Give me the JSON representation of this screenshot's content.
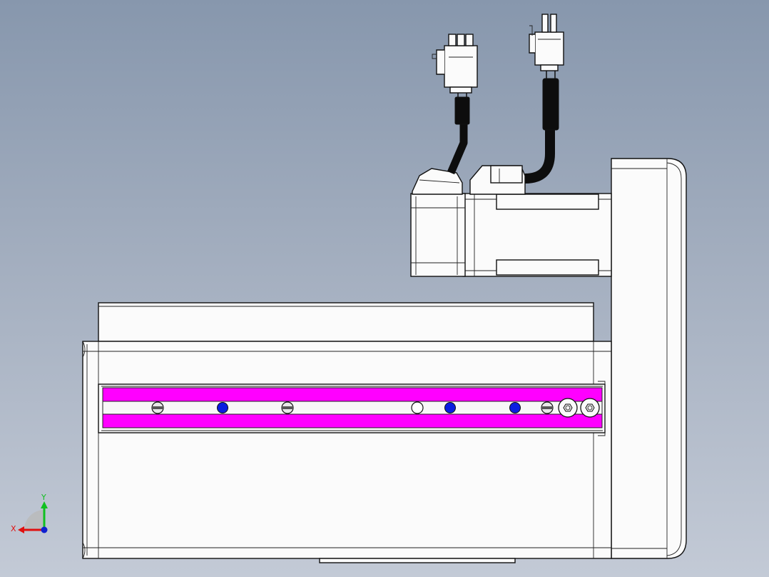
{
  "view": {
    "background_top": "#8797ad",
    "background_bottom": "#c3cad6"
  },
  "colors": {
    "highlight_strip": "#ff00ff",
    "marker_blue": "#0a1ee0",
    "cable": "#0d0d0d",
    "body": "#fbfbfb",
    "edge": "#111111"
  },
  "triad": {
    "x_label": "X",
    "y_label": "Y",
    "x_color": "#e01010",
    "y_color": "#10c020",
    "z_color": "#1020d0"
  },
  "icons": {
    "triad": "coordinate-triad-icon",
    "screw": "slotted-screw-icon",
    "washer": "hex-washer-icon",
    "connector": "connector-plug-icon"
  }
}
